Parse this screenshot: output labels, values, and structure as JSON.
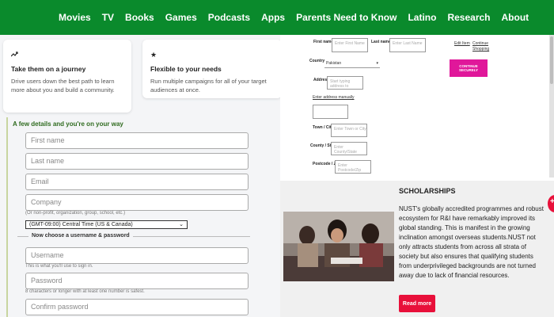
{
  "nav": {
    "items": [
      "Movies",
      "TV",
      "Books",
      "Games",
      "Podcasts",
      "Apps",
      "Parents Need to Know",
      "Latino",
      "Research",
      "About"
    ]
  },
  "cards": [
    {
      "icon": "trend-icon",
      "title": "Take them on a journey",
      "desc": "Drive users down the best path to learn more about you and build a community."
    },
    {
      "icon": "star-icon",
      "title": "Flexible to your needs",
      "desc": "Run multiple campaigns for all of your target audiences at once."
    }
  ],
  "signup": {
    "heading": "A few details and you're on your way",
    "first_name": "First name",
    "last_name": "Last name",
    "email": "Email",
    "company": "Company",
    "company_hint": "(Or non-profit, organization, group, school, etc.)",
    "timezone": "(GMT-09:00) Central Time (US & Canada)",
    "section": "Now choose a username & password",
    "username": "Username",
    "username_hint": "This is what you'll use to sign in.",
    "password": "Password",
    "password_hint": "8 characters or longer with at least one number is safest.",
    "confirm": "Confirm password"
  },
  "address": {
    "first_name_label": "First name *",
    "first_name_ph": "Enter First Name",
    "last_name_label": "Last name *",
    "last_name_ph": "Enter Last Name",
    "country_label": "Country",
    "country_value": "Pakistan",
    "address_label": "Address *",
    "address_ph": "Start typing address to",
    "manual_link": "Enter address manually",
    "town_label": "Town / City *",
    "town_ph": "Enter Town or City",
    "county_label": "County / State",
    "county_ph": "Enter County/State",
    "postcode_label": "Postcode / Zip *",
    "postcode_ph": "Enter Postcode/Zip",
    "edit_link": "Edit Item",
    "continue_link_1": "Continue",
    "continue_link_2": "Shopping",
    "continue_btn": "CONTINUE SECURELY"
  },
  "scholarships": {
    "title": "SCHOLARSHIPS",
    "text": "NUST's globally accredited programmes and robust ecosystem for R&I have remarkably improved its global standing. This is manifest in the growing inclination amongst overseas students.NUST not only attracts students from across all strata of society but also ensures that qualifying students from underprivileged backgrounds are not turned away due to lack of financial resources.",
    "button": "Read more"
  },
  "colors": {
    "nav_green": "#0a8a2c",
    "continue_pink": "#e0179a",
    "read_more_red": "#e8103a"
  }
}
